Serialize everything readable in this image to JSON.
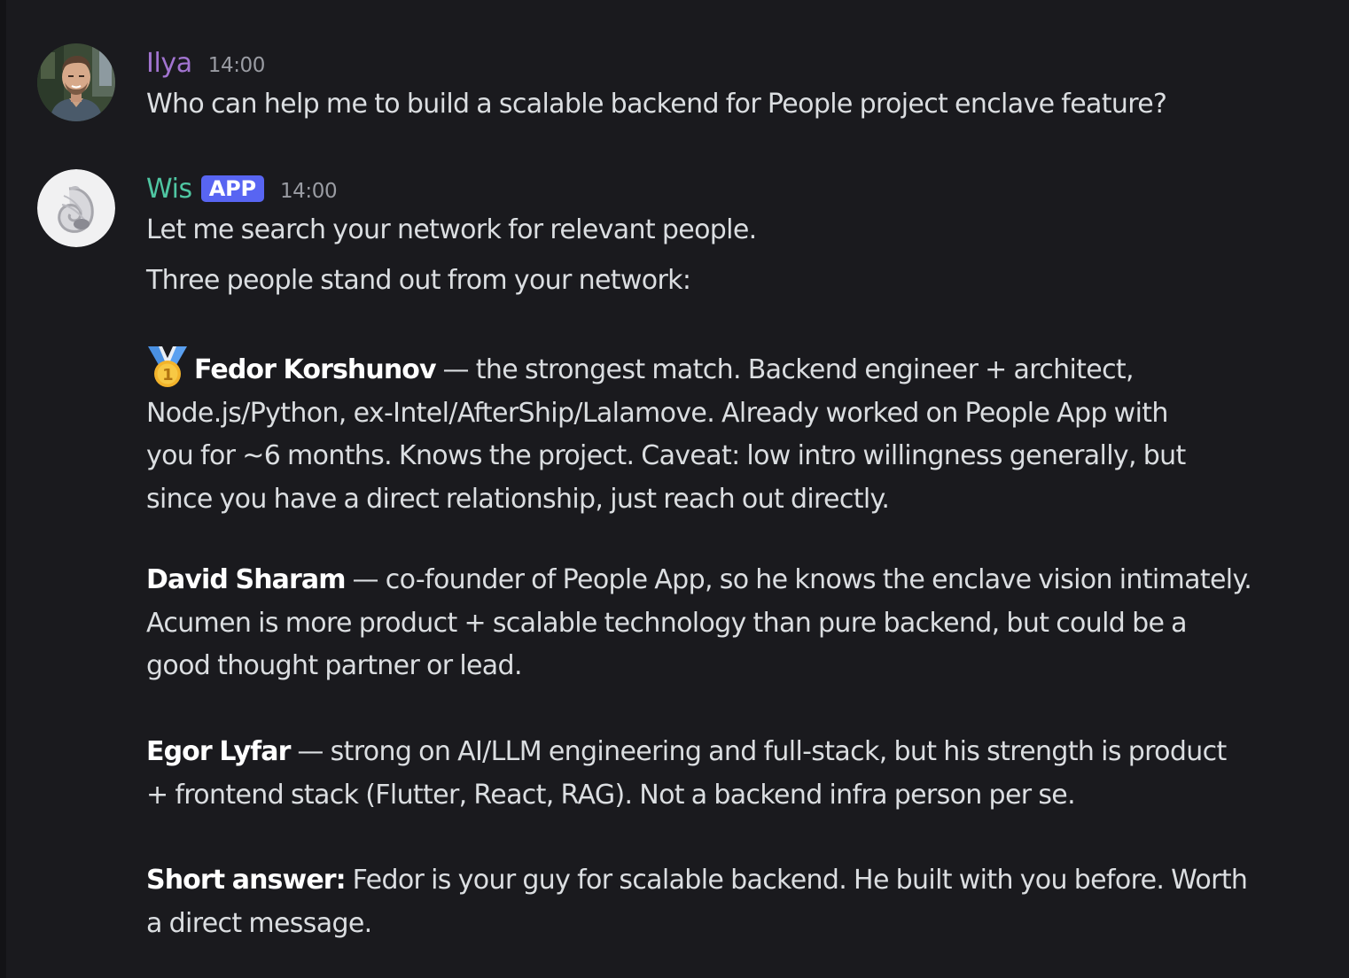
{
  "messages": [
    {
      "author": "Ilya",
      "time": "14:00",
      "text": "Who can help me to build a scalable backend for People project enclave feature?"
    },
    {
      "author": "Wis",
      "badge": "APP",
      "time": "14:00",
      "intro": "Let me search your network for relevant people.",
      "lead": "Three people stand out from your network:",
      "candidates": [
        {
          "icon": "gold-medal-icon",
          "name": "Fedor Korshunov",
          "lines": [
            " — the strongest match. Backend engineer + architect,",
            "Node.js/Python, ex-Intel/AfterShip/Lalamove. Already worked on People App with",
            "you for ~6 months. Knows the project. Caveat: low intro willingness generally, but",
            "since you have a direct relationship, just reach out directly."
          ]
        },
        {
          "name": "David Sharam",
          "lines": [
            " — co-founder of People App, so he knows the enclave vision intimately.",
            "Acumen is more product + scalable technology than pure backend, but could be a",
            "good thought partner or lead."
          ]
        },
        {
          "name": "Egor Lyfar",
          "lines": [
            " — strong on AI/LLM engineering and full-stack, but his strength is product",
            "+ frontend stack (Flutter, React, RAG). Not a backend infra person per se."
          ]
        }
      ],
      "summary": {
        "label": "Short answer:",
        "lines": [
          " Fedor is your guy for scalable backend. He built with you before. Worth",
          "a direct message."
        ]
      }
    }
  ],
  "colors": {
    "background": "#1a1a1e",
    "ilya_name": "#a274d0",
    "wis_name": "#4fc6a2",
    "app_badge": "#5865f2",
    "timestamp": "#9a9ca3",
    "text": "#dbdee1"
  }
}
